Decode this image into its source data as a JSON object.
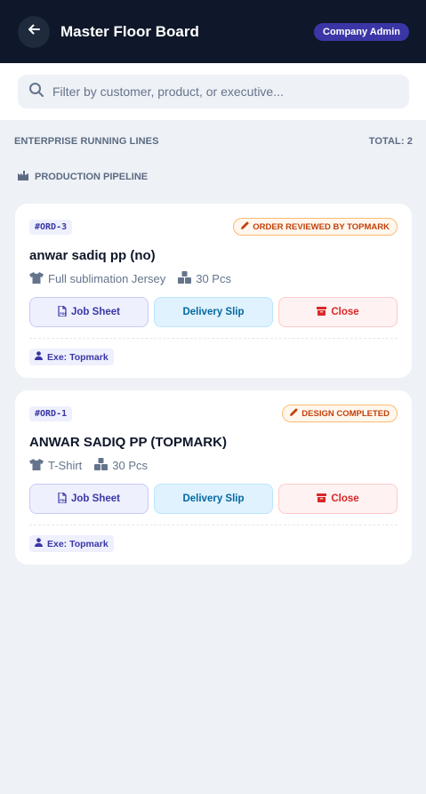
{
  "header": {
    "title": "Master Floor Board",
    "role_badge": "Company Admin"
  },
  "search": {
    "placeholder": "Filter by customer, product, or executive...",
    "value": ""
  },
  "section": {
    "title": "ENTERPRISE RUNNING LINES",
    "total": "TOTAL: 2"
  },
  "pipeline": {
    "label": "PRODUCTION PIPELINE"
  },
  "orders": [
    {
      "id": "#ORD-3",
      "status": "ORDER REVIEWED BY TOPMARK",
      "customer": "anwar sadiq pp (no)",
      "product": "Full sublimation Jersey",
      "quantity": "30 Pcs",
      "buttons": {
        "job_sheet": "Job Sheet",
        "delivery_slip": "Delivery Slip",
        "close": "Close"
      },
      "executive": "Exe: Topmark"
    },
    {
      "id": "#ORD-1",
      "status": "DESIGN COMPLETED",
      "customer": "ANWAR SADIQ PP (TOPMARK)",
      "product": "T-Shirt",
      "quantity": "30 Pcs",
      "buttons": {
        "job_sheet": "Job Sheet",
        "delivery_slip": "Delivery Slip",
        "close": "Close"
      },
      "executive": "Exe: Topmark"
    }
  ],
  "icons": {
    "back": "arrow-left-icon",
    "search": "search-icon",
    "pipeline": "factory-icon",
    "status": "pencil-icon",
    "product": "shirt-icon",
    "quantity": "boxes-icon",
    "job_sheet": "pdf-file-icon",
    "close": "archive-icon",
    "executive": "user-icon"
  },
  "colors": {
    "header_bg": "#0f172a",
    "accent": "#3b36a6",
    "status_orange": "#c2410c",
    "delivery_blue": "#0369a1",
    "close_red": "#dc2626"
  }
}
